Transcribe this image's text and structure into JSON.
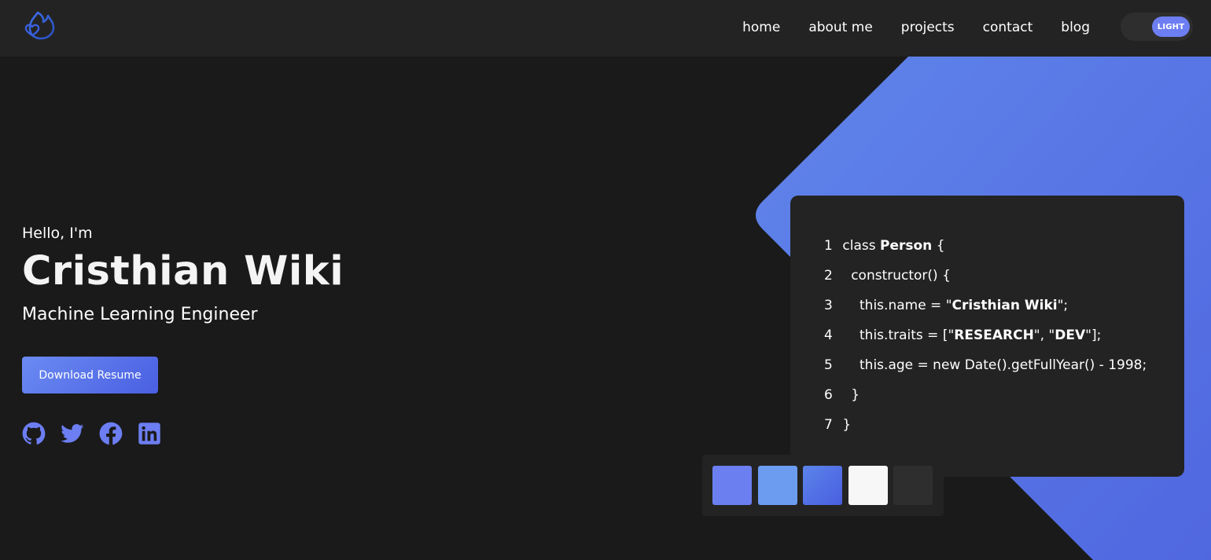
{
  "nav": {
    "links": [
      "home",
      "about me",
      "projects",
      "contact",
      "blog"
    ],
    "theme_toggle_label": "LIGHT"
  },
  "hero": {
    "greeting": "Hello, I'm",
    "name": "Cristhian Wiki",
    "role": "Machine Learning Engineer",
    "download_label": "Download Resume"
  },
  "socials": [
    {
      "icon": "github-icon"
    },
    {
      "icon": "twitter-icon"
    },
    {
      "icon": "facebook-icon"
    },
    {
      "icon": "linkedin-icon"
    }
  ],
  "code": {
    "lines": [
      {
        "num": "1",
        "parts": [
          [
            "class ",
            false
          ],
          [
            "Person",
            true
          ],
          [
            " {",
            false
          ]
        ]
      },
      {
        "num": "2",
        "parts": [
          [
            "  constructor() {",
            false
          ]
        ]
      },
      {
        "num": "3",
        "parts": [
          [
            "    this.name = \"",
            false
          ],
          [
            "Cristhian Wiki",
            true
          ],
          [
            "\";",
            false
          ]
        ]
      },
      {
        "num": "4",
        "parts": [
          [
            "    this.traits = [\"",
            false
          ],
          [
            "RESEARCH",
            true
          ],
          [
            "\", \"",
            false
          ],
          [
            "DEV",
            true
          ],
          [
            "\"];",
            false
          ]
        ]
      },
      {
        "num": "5",
        "parts": [
          [
            "    this.age = new Date().getFullYear() - 1998;",
            false
          ]
        ]
      },
      {
        "num": "6",
        "parts": [
          [
            "  }",
            false
          ]
        ]
      },
      {
        "num": "7",
        "parts": [
          [
            "}",
            false
          ]
        ]
      }
    ]
  },
  "palette": {
    "swatches": [
      "#6b7ff0",
      "#6c9cf0",
      "gradient:#5b84ea-#4a5ee0",
      "#f7f7f7",
      "#2e2e2e"
    ]
  },
  "colors": {
    "accent": "#6c7ef2",
    "accent_gradient": [
      "#6b8bf2",
      "#4a5fe2"
    ],
    "background": "#1a1a1a",
    "nav_background": "#232323",
    "card_background": "#232323",
    "shape_gradient": [
      "#6085ea",
      "#5067e0"
    ]
  }
}
